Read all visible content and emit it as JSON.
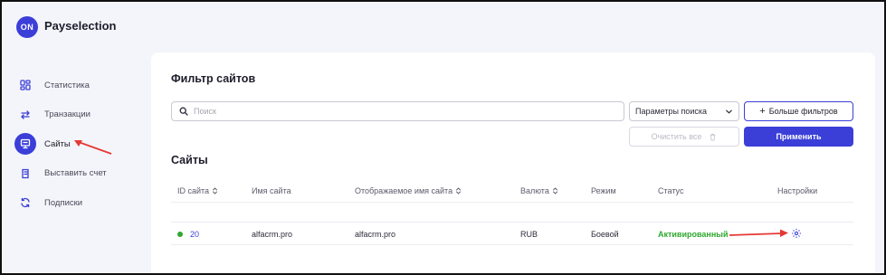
{
  "brand": {
    "badge": "ON",
    "name": "Payselection"
  },
  "sidebar": {
    "items": [
      {
        "label": "Статистика",
        "icon": "dashboard-icon",
        "active": false
      },
      {
        "label": "Транзакции",
        "icon": "transfer-icon",
        "active": false
      },
      {
        "label": "Сайты",
        "icon": "monitor-icon",
        "active": true
      },
      {
        "label": "Выставить счет",
        "icon": "invoice-icon",
        "active": false
      },
      {
        "label": "Подписки",
        "icon": "refresh-icon",
        "active": false
      }
    ]
  },
  "filter": {
    "title": "Фильтр сайтов",
    "search_placeholder": "Поиск",
    "search_value": "",
    "select_value": "Параметры поиска",
    "more_filters_label": "Больше фильтров",
    "clear_label": "Очистить все",
    "apply_label": "Применить"
  },
  "sites": {
    "title": "Сайты",
    "columns": [
      "ID сайта",
      "Имя сайта",
      "Отображаемое имя сайта",
      "Валюта",
      "Режим",
      "Статус",
      "Настройки"
    ],
    "rows": [
      {
        "id": "20",
        "name": "alfacrm.pro",
        "display_name": "alfacrm.pro",
        "currency": "RUB",
        "mode": "Боевой",
        "status": "Активированный"
      }
    ]
  },
  "colors": {
    "accent": "#3b3fd8",
    "status_active": "#2fa82f",
    "annotation_arrow": "#e53935"
  }
}
